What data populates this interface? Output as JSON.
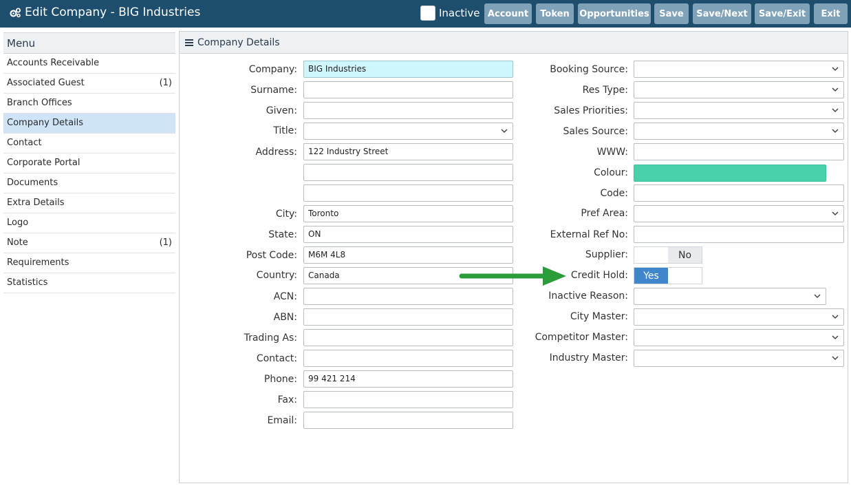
{
  "header": {
    "title": "Edit Company - BIG Industries",
    "inactive_label": "Inactive",
    "buttons": [
      "Account",
      "Token",
      "Opportunities",
      "Save",
      "Save/Next",
      "Save/Exit",
      "Exit"
    ]
  },
  "sidebar": {
    "header": "Menu",
    "items": [
      {
        "label": "Accounts Receivable",
        "count": ""
      },
      {
        "label": "Associated Guest",
        "count": "(1)"
      },
      {
        "label": "Branch Offices",
        "count": ""
      },
      {
        "label": "Company Details",
        "count": ""
      },
      {
        "label": "Contact",
        "count": ""
      },
      {
        "label": "Corporate Portal",
        "count": ""
      },
      {
        "label": "Documents",
        "count": ""
      },
      {
        "label": "Extra Details",
        "count": ""
      },
      {
        "label": "Logo",
        "count": ""
      },
      {
        "label": "Note",
        "count": "(1)"
      },
      {
        "label": "Requirements",
        "count": ""
      },
      {
        "label": "Statistics",
        "count": ""
      }
    ]
  },
  "panel": {
    "title": "Company Details",
    "left_fields": [
      {
        "label": "Company:",
        "value": "BIG Industries"
      },
      {
        "label": "Surname:",
        "value": ""
      },
      {
        "label": "Given:",
        "value": ""
      },
      {
        "label": "Title:",
        "value": ""
      },
      {
        "label": "Address:",
        "value": "122 Industry Street"
      },
      {
        "label": "",
        "value": ""
      },
      {
        "label": "",
        "value": ""
      },
      {
        "label": "City:",
        "value": "Toronto"
      },
      {
        "label": "State:",
        "value": "ON"
      },
      {
        "label": "Post Code:",
        "value": "M6M 4L8"
      },
      {
        "label": "Country:",
        "value": "Canada"
      },
      {
        "label": "ACN:",
        "value": ""
      },
      {
        "label": "ABN:",
        "value": ""
      },
      {
        "label": "Trading As:",
        "value": ""
      },
      {
        "label": "Contact:",
        "value": ""
      },
      {
        "label": "Phone:",
        "value": "99 421 214"
      },
      {
        "label": "Fax:",
        "value": ""
      },
      {
        "label": "Email:",
        "value": ""
      }
    ],
    "right_fields": [
      {
        "label": "Booking Source:",
        "value": ""
      },
      {
        "label": "Res Type:",
        "value": ""
      },
      {
        "label": "Sales Priorities:",
        "value": ""
      },
      {
        "label": "Sales Source:",
        "value": ""
      },
      {
        "label": "WWW:",
        "value": ""
      },
      {
        "label": "Colour:",
        "value": "#48d1aa"
      },
      {
        "label": "Code:",
        "value": ""
      },
      {
        "label": "Pref Area:",
        "value": ""
      },
      {
        "label": "External Ref No:",
        "value": ""
      },
      {
        "label": "Supplier:",
        "value": "No"
      },
      {
        "label": "Credit Hold:",
        "value": "Yes"
      },
      {
        "label": "Inactive Reason:",
        "value": ""
      },
      {
        "label": "City Master:",
        "value": ""
      },
      {
        "label": "Competitor Master:",
        "value": ""
      },
      {
        "label": "Industry Master:",
        "value": ""
      }
    ]
  },
  "colors": {
    "topbar": "#1e4e6e",
    "button": "#7fa2b8",
    "toggle_on": "#3f86cc",
    "arrow": "#2a9d3a",
    "colour_field": "#48d1aa"
  }
}
